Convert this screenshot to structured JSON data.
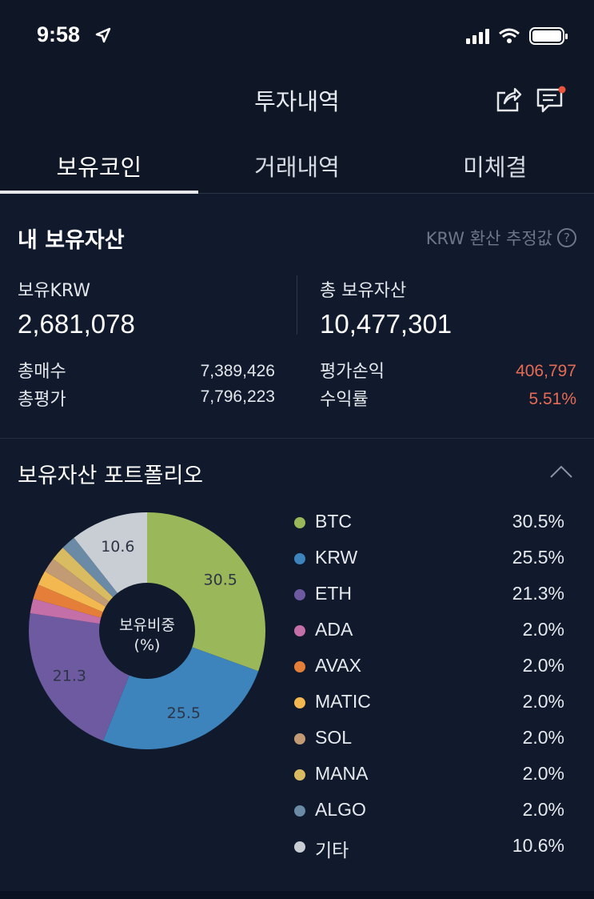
{
  "status": {
    "time": "9:58"
  },
  "header": {
    "title": "투자내역"
  },
  "tabs": [
    {
      "label": "보유코인",
      "active": true
    },
    {
      "label": "거래내역",
      "active": false
    },
    {
      "label": "미체결",
      "active": false
    }
  ],
  "assets": {
    "title": "내 보유자산",
    "estimate_note": "KRW 환산 추정값",
    "krw_label": "보유KRW",
    "krw_value": "2,681,078",
    "total_label": "총 보유자산",
    "total_value": "10,477,301",
    "buy_label": "총매수",
    "buy_value": "7,389,426",
    "eval_label": "총평가",
    "eval_value": "7,796,223",
    "pnl_label": "평가손익",
    "pnl_value": "406,797",
    "rate_label": "수익률",
    "rate_value": "5.51%"
  },
  "portfolio": {
    "title": "보유자산 포트폴리오",
    "center_line1": "보유비중",
    "center_line2": "(%)",
    "items": [
      {
        "name": "BTC",
        "percent": "30.5%",
        "color": "#9ab75a"
      },
      {
        "name": "KRW",
        "percent": "25.5%",
        "color": "#3d84bd"
      },
      {
        "name": "ETH",
        "percent": "21.3%",
        "color": "#6e5aa1"
      },
      {
        "name": "ADA",
        "percent": "2.0%",
        "color": "#c56fa8"
      },
      {
        "name": "AVAX",
        "percent": "2.0%",
        "color": "#e57e38"
      },
      {
        "name": "MATIC",
        "percent": "2.0%",
        "color": "#f3b84f"
      },
      {
        "name": "SOL",
        "percent": "2.0%",
        "color": "#c29b74"
      },
      {
        "name": "MANA",
        "percent": "2.0%",
        "color": "#d9bb62"
      },
      {
        "name": "ALGO",
        "percent": "2.0%",
        "color": "#6b8aa6"
      },
      {
        "name": "기타",
        "percent": "10.6%",
        "color": "#c9cdd4"
      }
    ]
  },
  "chart_data": {
    "type": "pie",
    "categories": [
      "BTC",
      "KRW",
      "ETH",
      "ADA",
      "AVAX",
      "MATIC",
      "SOL",
      "MANA",
      "ALGO",
      "기타"
    ],
    "values": [
      30.5,
      25.5,
      21.3,
      2.0,
      2.0,
      2.0,
      2.0,
      2.0,
      2.0,
      10.6
    ],
    "slice_labels": [
      "30.5",
      "25.5",
      "21.3",
      "",
      "",
      "",
      "",
      "",
      "",
      "10.6"
    ],
    "colors": [
      "#9ab75a",
      "#3d84bd",
      "#6e5aa1",
      "#c56fa8",
      "#e57e38",
      "#f3b84f",
      "#c29b74",
      "#d9bb62",
      "#6b8aa6",
      "#c9cdd4"
    ]
  }
}
